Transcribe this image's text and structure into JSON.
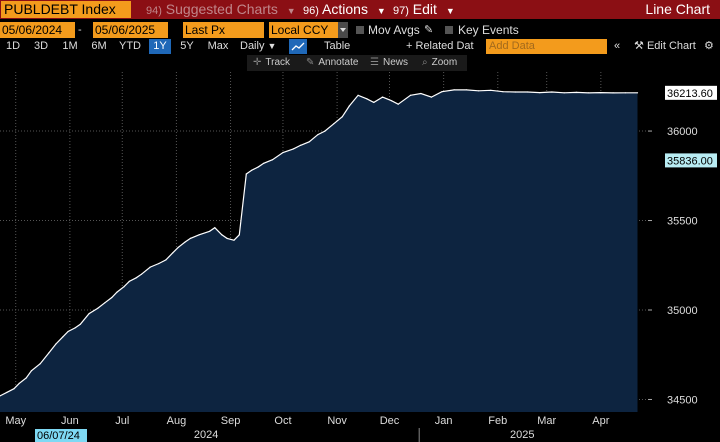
{
  "titlebar": {
    "security": "PUBLDEBT Index",
    "suggested_num": "94)",
    "suggested": "Suggested Charts",
    "actions_num": "96)",
    "actions": "Actions",
    "edit_num": "97)",
    "edit": "Edit",
    "window_title": "Line Chart"
  },
  "controls": {
    "start_date": "05/06/2024",
    "end_date": "05/06/2025",
    "date_separator": "-",
    "field": "Last Px",
    "currency": "Local CCY",
    "mov_avgs": "Mov Avgs",
    "key_events": "Key Events"
  },
  "periods": {
    "items": [
      "1D",
      "3D",
      "1M",
      "6M",
      "YTD",
      "1Y",
      "5Y",
      "Max"
    ],
    "active": "1Y",
    "frequency": "Daily",
    "table": "Table",
    "related_data": "Related Dat",
    "add_data_placeholder": "Add Data",
    "edit_chart": "Edit Chart"
  },
  "tools": {
    "track": "Track",
    "annotate": "Annotate",
    "news": "News",
    "zoom": "Zoom"
  },
  "colors": {
    "brand_bar": "#8b0f14",
    "highlight": "#f39b1c",
    "active_blue": "#1f68b8",
    "area_fill": "#0d2440",
    "line": "#ffffff",
    "date_box": "#7ed9f4"
  },
  "chart_data": {
    "type": "area",
    "title": "PUBLDEBT Index",
    "xlabel": "",
    "ylabel": "",
    "ylim": [
      34430,
      36330
    ],
    "y_ticks": [
      34500,
      35000,
      35500,
      36000
    ],
    "x_month_labels": [
      "May",
      "Jun",
      "Jul",
      "Aug",
      "Sep",
      "Oct",
      "Nov",
      "Dec",
      "Jan",
      "Feb",
      "Mar",
      "Apr"
    ],
    "x_month_dates": [
      "2024-05-15",
      "2024-06-15",
      "2024-07-15",
      "2024-08-15",
      "2024-09-15",
      "2024-10-15",
      "2024-11-15",
      "2024-12-15",
      "2025-01-15",
      "2025-02-15",
      "2025-03-15",
      "2025-04-15"
    ],
    "year_labels": [
      {
        "label": "2024",
        "date": "2024-09-01"
      },
      {
        "label": "2025",
        "date": "2025-03-01"
      }
    ],
    "x_start": "2024-05-06",
    "x_end": "2025-05-12",
    "last_value_label": "36213.60",
    "last_value": 36213.6,
    "secondary_value_label": "35836.00",
    "secondary_value": 35836.0,
    "date_marker": "06/07/24",
    "grid": true,
    "legend": "none",
    "x": [
      "2024-05-06",
      "2024-05-10",
      "2024-05-14",
      "2024-05-17",
      "2024-05-21",
      "2024-05-24",
      "2024-05-29",
      "2024-06-03",
      "2024-06-07",
      "2024-06-11",
      "2024-06-14",
      "2024-06-18",
      "2024-06-21",
      "2024-06-26",
      "2024-07-01",
      "2024-07-05",
      "2024-07-09",
      "2024-07-12",
      "2024-07-16",
      "2024-07-19",
      "2024-07-23",
      "2024-07-26",
      "2024-07-31",
      "2024-08-05",
      "2024-08-09",
      "2024-08-13",
      "2024-08-16",
      "2024-08-20",
      "2024-08-23",
      "2024-08-28",
      "2024-09-03",
      "2024-09-06",
      "2024-09-10",
      "2024-09-13",
      "2024-09-17",
      "2024-09-20",
      "2024-09-24",
      "2024-09-27",
      "2024-10-01",
      "2024-10-04",
      "2024-10-09",
      "2024-10-15",
      "2024-10-21",
      "2024-10-25",
      "2024-10-30",
      "2024-11-04",
      "2024-11-08",
      "2024-11-13",
      "2024-11-18",
      "2024-11-22",
      "2024-11-27",
      "2024-12-02",
      "2024-12-06",
      "2024-12-11",
      "2024-12-16",
      "2024-12-20",
      "2024-12-27",
      "2025-01-02",
      "2025-01-08",
      "2025-01-14",
      "2025-01-21",
      "2025-01-28",
      "2025-02-04",
      "2025-02-11",
      "2025-02-18",
      "2025-02-25",
      "2025-03-04",
      "2025-03-11",
      "2025-03-18",
      "2025-03-25",
      "2025-04-01",
      "2025-04-08",
      "2025-04-15",
      "2025-04-22",
      "2025-04-29",
      "2025-05-06"
    ],
    "y": [
      34520,
      34540,
      34560,
      34590,
      34620,
      34660,
      34700,
      34760,
      34810,
      34850,
      34880,
      34900,
      34920,
      34980,
      35010,
      35040,
      35070,
      35100,
      35130,
      35160,
      35180,
      35200,
      35240,
      35260,
      35280,
      35320,
      35350,
      35380,
      35400,
      35420,
      35440,
      35460,
      35420,
      35400,
      35390,
      35420,
      35760,
      35780,
      35800,
      35820,
      35840,
      35880,
      35900,
      35920,
      35940,
      35980,
      36000,
      36040,
      36080,
      36140,
      36200,
      36180,
      36160,
      36190,
      36170,
      36150,
      36200,
      36210,
      36190,
      36220,
      36230,
      36230,
      36225,
      36228,
      36220,
      36218,
      36218,
      36215,
      36218,
      36214,
      36216,
      36213,
      36215,
      36213,
      36214,
      36213.6
    ]
  }
}
